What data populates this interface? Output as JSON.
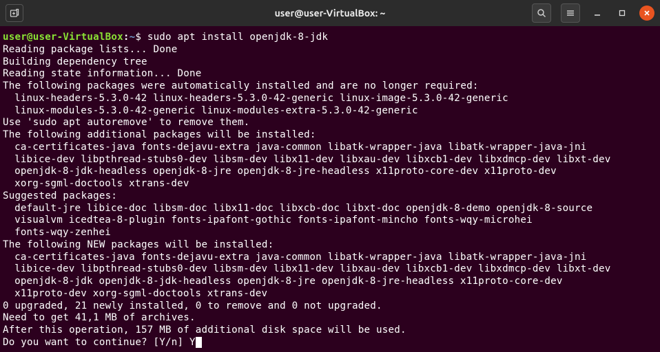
{
  "titlebar": {
    "title": "user@user-VirtualBox: ~"
  },
  "prompt": {
    "user_host": "user@user-VirtualBox",
    "colon": ":",
    "path": "~",
    "dollar": "$ "
  },
  "command": "sudo apt install openjdk-8-jdk",
  "lines": {
    "l1": "Reading package lists... Done",
    "l2": "Building dependency tree",
    "l3": "Reading state information... Done",
    "l4": "The following packages were automatically installed and are no longer required:",
    "l5": "linux-headers-5.3.0-42 linux-headers-5.3.0-42-generic linux-image-5.3.0-42-generic",
    "l6": "linux-modules-5.3.0-42-generic linux-modules-extra-5.3.0-42-generic",
    "l7": "Use 'sudo apt autoremove' to remove them.",
    "l8": "The following additional packages will be installed:",
    "l9": "ca-certificates-java fonts-dejavu-extra java-common libatk-wrapper-java libatk-wrapper-java-jni",
    "l10": "libice-dev libpthread-stubs0-dev libsm-dev libx11-dev libxau-dev libxcb1-dev libxdmcp-dev libxt-dev",
    "l11": "openjdk-8-jdk-headless openjdk-8-jre openjdk-8-jre-headless x11proto-core-dev x11proto-dev",
    "l12": "xorg-sgml-doctools xtrans-dev",
    "l13": "Suggested packages:",
    "l14": "default-jre libice-doc libsm-doc libx11-doc libxcb-doc libxt-doc openjdk-8-demo openjdk-8-source",
    "l15": "visualvm icedtea-8-plugin fonts-ipafont-gothic fonts-ipafont-mincho fonts-wqy-microhei",
    "l16": "fonts-wqy-zenhei",
    "l17": "The following NEW packages will be installed:",
    "l18": "ca-certificates-java fonts-dejavu-extra java-common libatk-wrapper-java libatk-wrapper-java-jni",
    "l19": "libice-dev libpthread-stubs0-dev libsm-dev libx11-dev libxau-dev libxcb1-dev libxdmcp-dev libxt-dev",
    "l20": "openjdk-8-jdk openjdk-8-jdk-headless openjdk-8-jre openjdk-8-jre-headless x11proto-core-dev",
    "l21": "x11proto-dev xorg-sgml-doctools xtrans-dev",
    "l22": "0 upgraded, 21 newly installed, 0 to remove and 0 not upgraded.",
    "l23": "Need to get 41,1 MB of archives.",
    "l24": "After this operation, 157 MB of additional disk space will be used.",
    "l25": "Do you want to continue? [Y/n] Y"
  }
}
